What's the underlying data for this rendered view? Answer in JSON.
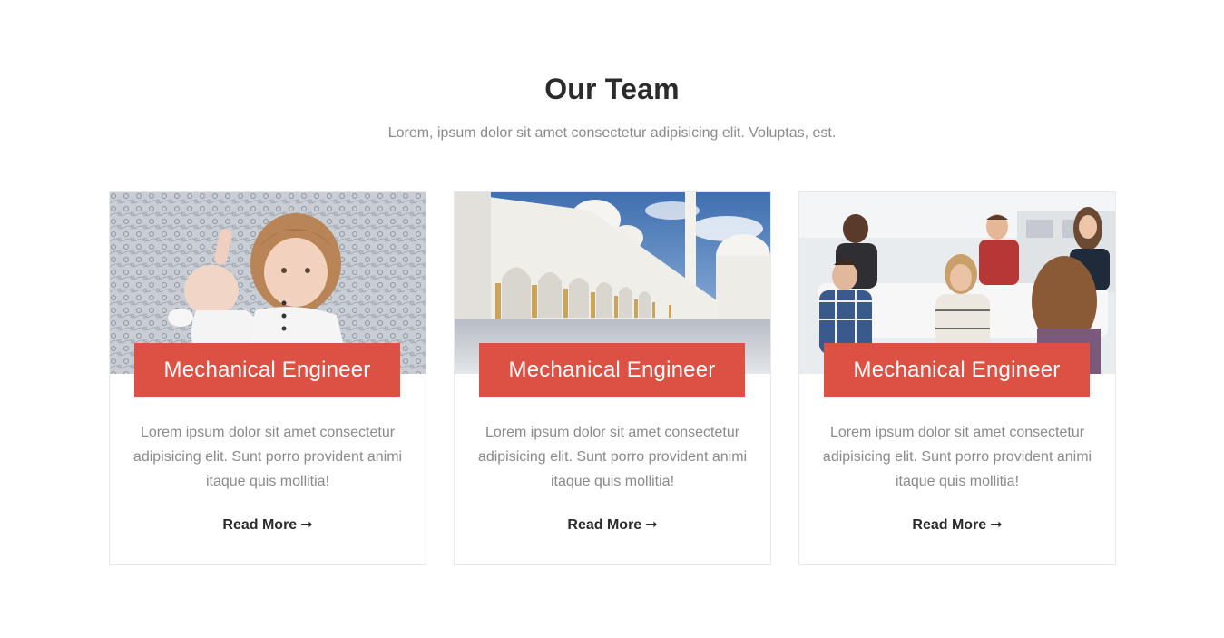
{
  "section": {
    "title": "Our Team",
    "subtitle": "Lorem, ipsum dolor sit amet consectetur adipisicing elit. Voluptas, est."
  },
  "colors": {
    "accent": "#dd5044",
    "heading": "#2b2b2b",
    "muted_text": "#8a8a8a",
    "card_border": "#e8e8e8"
  },
  "cards": [
    {
      "photo": "children-lying-on-blanket-photo",
      "role": "Mechanical Engineer",
      "text": "Lorem ipsum dolor sit amet consectetur adipisicing elit. Sunt porro provident animi itaque quis mollitia!",
      "link_label": "Read More",
      "link_icon": "arrow-right-icon"
    },
    {
      "photo": "white-mosque-colonnade-photo",
      "role": "Mechanical Engineer",
      "text": "Lorem ipsum dolor sit amet consectetur adipisicing elit. Sunt porro provident animi itaque quis mollitia!",
      "link_label": "Read More",
      "link_icon": "arrow-right-icon"
    },
    {
      "photo": "office-team-meeting-photo",
      "role": "Mechanical Engineer",
      "text": "Lorem ipsum dolor sit amet consectetur adipisicing elit. Sunt porro provident animi itaque quis mollitia!",
      "link_label": "Read More",
      "link_icon": "arrow-right-icon"
    }
  ]
}
